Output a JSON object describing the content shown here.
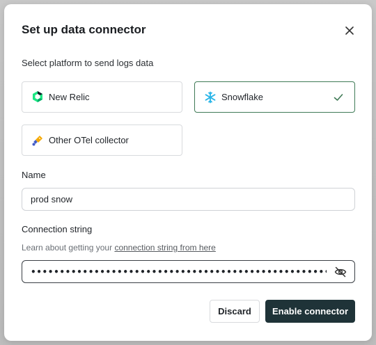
{
  "dialog": {
    "title": "Set up data connector",
    "close_icon": "close-icon"
  },
  "platform": {
    "label": "Select platform to send logs data",
    "options": [
      {
        "label": "New Relic",
        "icon": "new-relic-icon",
        "selected": false
      },
      {
        "label": "Snowflake",
        "icon": "snowflake-icon",
        "selected": true
      },
      {
        "label": "Other OTel collector",
        "icon": "otel-icon",
        "selected": false
      }
    ],
    "selected_color": "#3f7a56"
  },
  "name_field": {
    "label": "Name",
    "value": "prod snow"
  },
  "connection_field": {
    "label": "Connection string",
    "help_prefix": "Learn about getting your ",
    "help_link": "connection string from here",
    "masked_value": "••••••••••••••••••••••••••••••••••••••••••••••••••••••••••••",
    "toggle_icon": "eye-off-icon"
  },
  "actions": {
    "discard_label": "Discard",
    "enable_label": "Enable connector",
    "primary_color": "#1f3338"
  }
}
